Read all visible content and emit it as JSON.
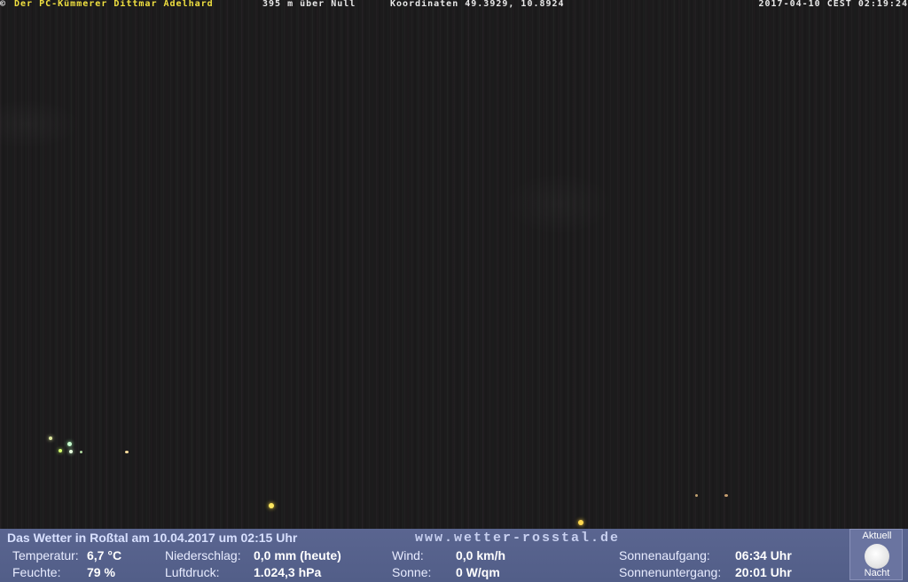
{
  "overlay": {
    "copyright": "©",
    "owner": "Der PC-Kümmerer Dittmar Adelhard",
    "altitude": "395 m über Null",
    "coordinates": "Koordinaten 49.3929, 10.8924",
    "timestamp": "2017-04-10 CEST 02:19:24"
  },
  "weather": {
    "title": "Das Wetter in Roßtal am 10.04.2017 um 02:15 Uhr",
    "url": "www.wetter-rosstal.de",
    "temperature": {
      "label": "Temperatur:",
      "value": "6,7 °C"
    },
    "humidity": {
      "label": "Feuchte:",
      "value": "79 %"
    },
    "precipitation": {
      "label": "Niederschlag:",
      "value": "0,0 mm (heute)"
    },
    "pressure": {
      "label": "Luftdruck:",
      "value": "1.024,3 hPa"
    },
    "wind": {
      "label": "Wind:",
      "value": "0,0 km/h"
    },
    "sun": {
      "label": "Sonne:",
      "value": "0 W/qm"
    },
    "sunrise": {
      "label": "Sonnenaufgang:",
      "value": "06:34 Uhr"
    },
    "sunset": {
      "label": "Sonnenuntergang:",
      "value": "20:01 Uhr"
    }
  },
  "moon": {
    "top_label": "Aktuell",
    "bottom_label": "Nacht",
    "icon": "full-moon-icon"
  },
  "colors": {
    "owner_text": "#f0e040",
    "bar_background": "#5a6590"
  }
}
